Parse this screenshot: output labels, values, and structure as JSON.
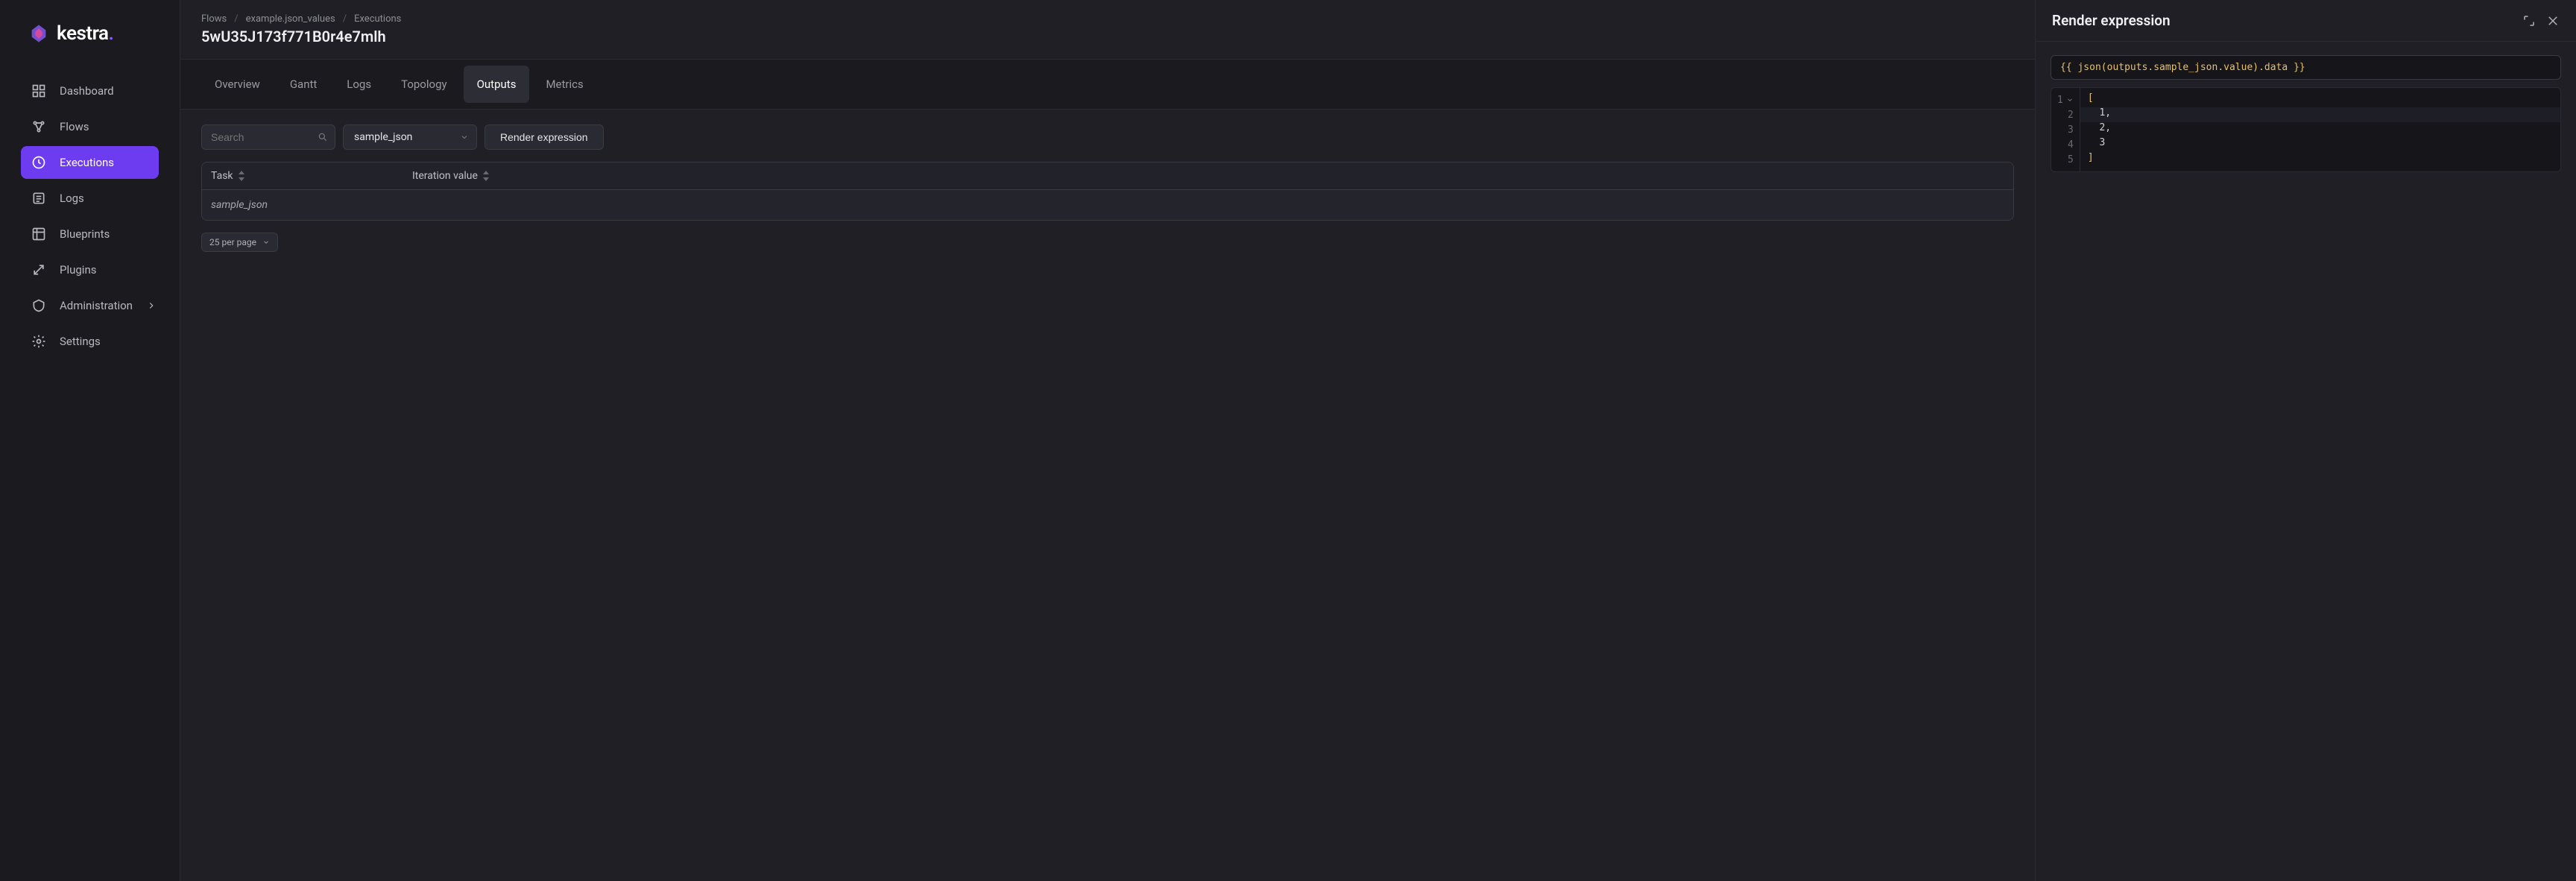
{
  "brand": {
    "name": "kestra"
  },
  "sidebar": {
    "items": [
      {
        "label": "Dashboard",
        "icon": "dashboard-icon"
      },
      {
        "label": "Flows",
        "icon": "flows-icon"
      },
      {
        "label": "Executions",
        "icon": "executions-icon",
        "active": true
      },
      {
        "label": "Logs",
        "icon": "logs-icon"
      },
      {
        "label": "Blueprints",
        "icon": "blueprints-icon"
      },
      {
        "label": "Plugins",
        "icon": "plugins-icon"
      },
      {
        "label": "Administration",
        "icon": "admin-icon",
        "expandable": true
      },
      {
        "label": "Settings",
        "icon": "settings-icon"
      }
    ]
  },
  "breadcrumb": {
    "items": [
      "Flows",
      "example.json_values",
      "Executions"
    ]
  },
  "page": {
    "title": "5wU35J173f771B0r4e7mlh"
  },
  "tabs": {
    "items": [
      "Overview",
      "Gantt",
      "Logs",
      "Topology",
      "Outputs",
      "Metrics"
    ],
    "active": "Outputs"
  },
  "controls": {
    "search_placeholder": "Search",
    "select_value": "sample_json",
    "render_btn": "Render expression"
  },
  "table": {
    "headers": {
      "task": "Task",
      "iteration": "Iteration value"
    },
    "rows": [
      {
        "task": "sample_json"
      }
    ]
  },
  "pagination": {
    "label": "25 per page"
  },
  "panel": {
    "title": "Render expression",
    "expression": "{{ json(outputs.sample_json.value).data }}",
    "output_lines": [
      {
        "n": "1",
        "fold": true,
        "text": "[",
        "cls": "bracket"
      },
      {
        "n": "2",
        "text": "  1,",
        "cls": "text",
        "hl": true
      },
      {
        "n": "3",
        "text": "  2,",
        "cls": "text"
      },
      {
        "n": "4",
        "text": "  3",
        "cls": "text"
      },
      {
        "n": "5",
        "text": "]",
        "cls": "bracket"
      }
    ]
  }
}
